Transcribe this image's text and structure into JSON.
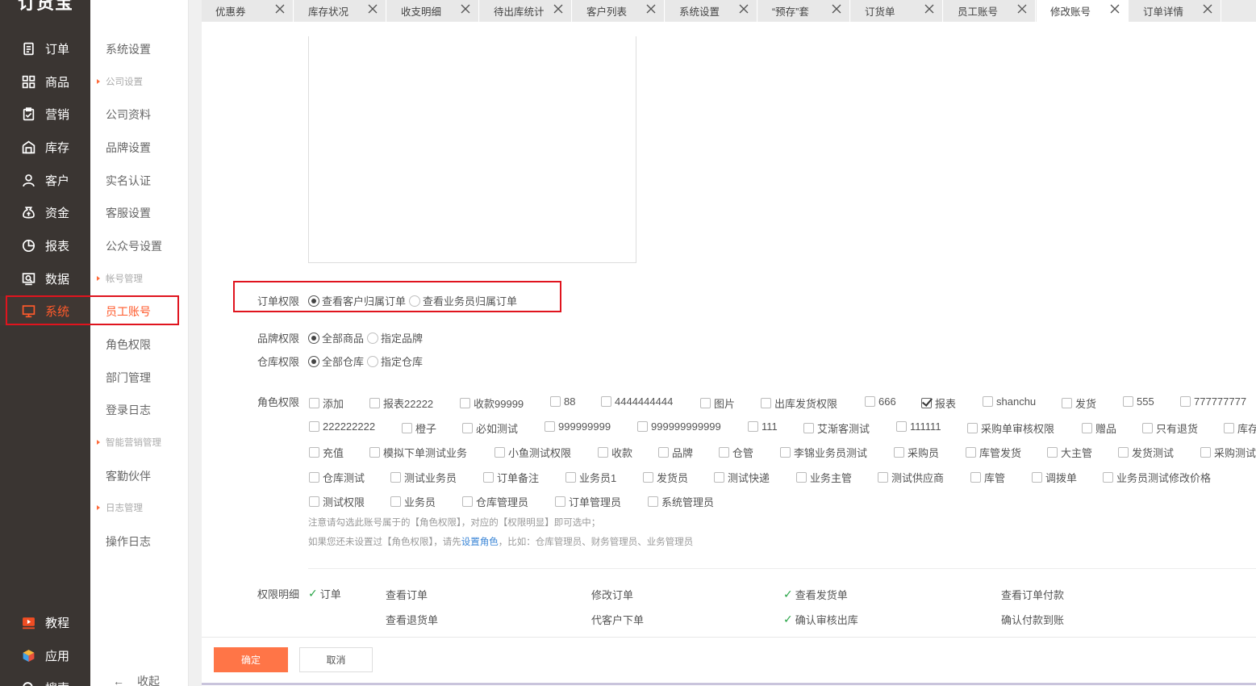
{
  "app": {
    "logo": "订货宝"
  },
  "sidebar": {
    "items": [
      {
        "label": "订单",
        "icon": "document-icon"
      },
      {
        "label": "商品",
        "icon": "grid-icon"
      },
      {
        "label": "营销",
        "icon": "clipboard-icon"
      },
      {
        "label": "库存",
        "icon": "warehouse-icon"
      },
      {
        "label": "客户",
        "icon": "person-icon"
      },
      {
        "label": "资金",
        "icon": "money-bag-icon"
      },
      {
        "label": "报表",
        "icon": "pie-chart-icon"
      },
      {
        "label": "数据",
        "icon": "data-monitor-icon"
      },
      {
        "label": "系统",
        "icon": "monitor-icon"
      }
    ],
    "bottom": [
      {
        "label": "教程",
        "icon": "play-icon"
      },
      {
        "label": "应用",
        "icon": "cube-icon"
      },
      {
        "label": "搜索",
        "icon": "search-icon"
      }
    ],
    "active": "系统"
  },
  "subnav": {
    "title": "系统设置",
    "groups": [
      {
        "label": "公司设置",
        "items": [
          "公司资料",
          "品牌设置",
          "实名认证",
          "客服设置",
          "公众号设置"
        ]
      },
      {
        "label": "帐号管理",
        "items": [
          "员工账号",
          "角色权限",
          "部门管理",
          "登录日志"
        ]
      },
      {
        "label": "智能营销管理",
        "items": [
          "客勤伙伴"
        ]
      },
      {
        "label": "日志管理",
        "items": [
          "操作日志"
        ]
      }
    ],
    "active": "员工账号",
    "collapse": "收起"
  },
  "tabs": [
    "优惠券",
    "库存状况",
    "收支明细",
    "待出库统计",
    "客户列表",
    "系统设置",
    "“预存”套",
    "订货单",
    "员工账号",
    "修改账号",
    "订单详情"
  ],
  "active_tab": "修改账号",
  "form": {
    "order_perm": {
      "label": "订单权限",
      "options": [
        "查看客户归属订单",
        "查看业务员归属订单"
      ],
      "selected": "查看客户归属订单"
    },
    "brand_perm": {
      "label": "品牌权限",
      "options": [
        "全部商品",
        "指定品牌"
      ],
      "selected": "全部商品"
    },
    "warehouse_perm": {
      "label": "仓库权限",
      "options": [
        "全部仓库",
        "指定仓库"
      ],
      "selected": "全部仓库"
    },
    "role_perm": {
      "label": "角色权限",
      "rows": [
        [
          "添加",
          "报表22222",
          "收款99999",
          "88",
          "4444444444",
          "图片",
          "出库发货权限",
          "666",
          "报表",
          "shanchu",
          "发货",
          "555",
          "777777777"
        ],
        [
          "222222222",
          "橙子",
          "必如测试",
          "999999999",
          "999999999999",
          "111",
          "艾渐客测试",
          "111111",
          "采购单审核权限",
          "赠品",
          "只有退货",
          "库存"
        ],
        [
          "充值",
          "模拟下单测试业务",
          "小鱼测试权限",
          "收款",
          "品牌",
          "仓管",
          "李锦业务员测试",
          "采购员",
          "库管发货",
          "大主管",
          "发货测试",
          "采购测试"
        ],
        [
          "仓库测试",
          "测试业务员",
          "订单备注",
          "业务员1",
          "发货员",
          "测试快递",
          "业务主管",
          "测试供应商",
          "库管",
          "调拨单",
          "业务员测试修改价格"
        ],
        [
          "测试权限",
          "业务员",
          "仓库管理员",
          "订单管理员",
          "系统管理员"
        ]
      ],
      "checked": [
        "报表"
      ],
      "note1": "注意请勾选此账号属于的【角色权限】，对应的【权限明显】即可选中；",
      "note2_pre": "如果您还未设置过【角色权限】，请先",
      "note2_link": "设置角色",
      "note2_post": "，比如：仓库管理员、财务管理员、业务管理员"
    },
    "perm_detail": {
      "label": "权限明细",
      "row1": [
        {
          "text": "订单",
          "checked": true
        },
        {
          "text": "查看订单",
          "checked": false
        },
        {
          "text": "修改订单",
          "checked": false
        },
        {
          "text": "查看发货单",
          "checked": true
        },
        {
          "text": "查看订单付款",
          "checked": false
        }
      ],
      "row2": [
        {
          "text": "查看退货单",
          "checked": false
        },
        {
          "text": "代客户下单",
          "checked": false
        },
        {
          "text": "确认审核出库",
          "checked": true
        },
        {
          "text": "确认付款到账",
          "checked": false
        }
      ]
    },
    "buttons": {
      "ok": "确定",
      "cancel": "取消"
    }
  },
  "colors": {
    "accent": "#ff7547",
    "sidebar_bg": "#3a3532",
    "highlight_box": "#e0141e",
    "check": "#2aa548",
    "link": "#3b86d6"
  }
}
